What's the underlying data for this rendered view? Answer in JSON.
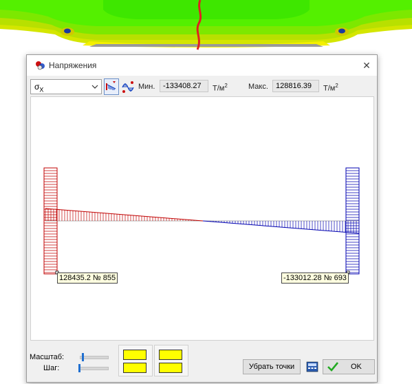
{
  "window": {
    "title": "Напряжения",
    "close_glyph": "✕"
  },
  "toolbar": {
    "component_select": {
      "symbol": "σ",
      "subscript": "X"
    },
    "min_label": "Мин.",
    "min_value": "-133408.27",
    "max_label": "Макс.",
    "max_value": "128816.39",
    "unit_base": "Т/м",
    "unit_exp": "2"
  },
  "plot": {
    "left_tag": "128435.2 № 855",
    "right_tag": "-133012.28 № 693",
    "positive_color": "#c00000",
    "negative_color": "#0000b0"
  },
  "footer": {
    "scale_label": "Масштаб:",
    "step_label": "Шаг:",
    "remove_points_label": "Убрать точки",
    "ok_label": "OK"
  },
  "icons": {
    "title": "stress-app-icon",
    "select_caret": "chevron-down-icon",
    "ok": "checkmark-icon",
    "extra": "calculator-icon"
  }
}
